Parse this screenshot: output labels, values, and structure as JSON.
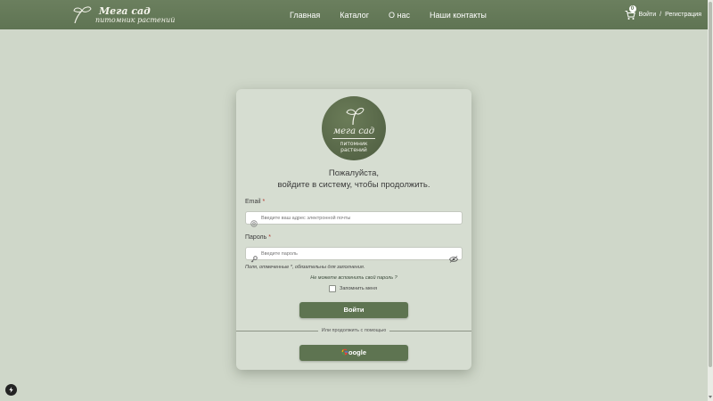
{
  "header": {
    "logo_title": "Мега сад",
    "logo_subtitle": "питомник растений",
    "nav": [
      "Главная",
      "Каталог",
      "О нас",
      "Наши контакты"
    ],
    "cart_count": "0",
    "login_label": "Войти",
    "separator": "/",
    "register_label": "Регистрация"
  },
  "card": {
    "logo_title": "мега сад",
    "logo_sub_line1": "питомник",
    "logo_sub_line2": "растений",
    "welcome_line1": "Пожалуйста,",
    "welcome_line2": "войдите в систему, чтобы продолжить.",
    "email_label": "Email",
    "email_placeholder": "Введите ваш адрес электронной почты",
    "password_label": "Пароль",
    "password_placeholder": "Введите пароль",
    "required_mark": "*",
    "required_note": "Поля, отмеченные *, обязательны для заполнения.",
    "forgot_label": "Не можете вспомнить свой пароль ?",
    "remember_label": "Запомнить меня",
    "submit_label": "Войти",
    "divider_text": "Или продолжить с помощью",
    "google_label": "oogle"
  },
  "colors": {
    "header_bg": "#617655",
    "page_bg": "#cfd7c9",
    "button_bg": "#5e7451",
    "required": "#b2382f"
  }
}
